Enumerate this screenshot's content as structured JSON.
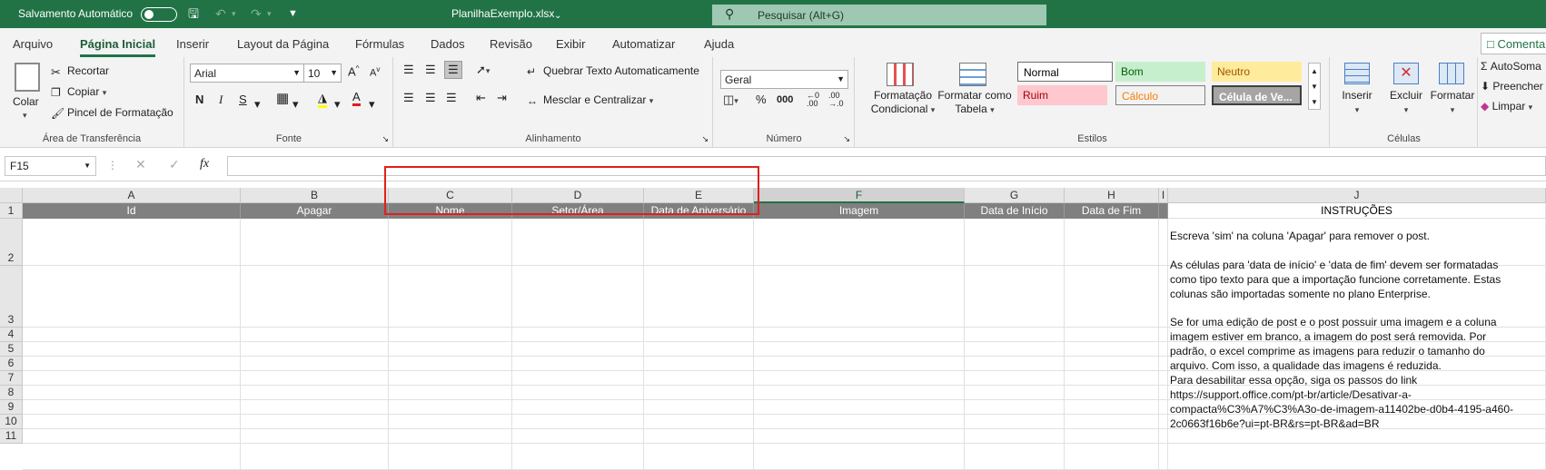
{
  "titlebar": {
    "autosave_label": "Salvamento Automático",
    "file_name": "PlanilhaExemplo.xlsx",
    "search_placeholder": "Pesquisar (Alt+G)"
  },
  "menu": {
    "items": [
      "Arquivo",
      "Página Inicial",
      "Inserir",
      "Layout da Página",
      "Fórmulas",
      "Dados",
      "Revisão",
      "Exibir",
      "Automatizar",
      "Ajuda"
    ],
    "active": "Página Inicial",
    "comment_button": "Comenta"
  },
  "ribbon": {
    "clipboard": {
      "paste": "Colar",
      "cut": "Recortar",
      "copy": "Copiar",
      "format_painter": "Pincel de Formatação",
      "label": "Área de Transferência"
    },
    "font": {
      "font_name": "Arial",
      "font_size": "10",
      "label": "Fonte",
      "bold": "N",
      "italic": "I",
      "underline": "S"
    },
    "alignment": {
      "wrap_text": "Quebrar Texto Automaticamente",
      "merge_center": "Mesclar e Centralizar",
      "label": "Alinhamento"
    },
    "number": {
      "format": "Geral",
      "label": "Número"
    },
    "styles": {
      "conditional": [
        "Formatação",
        "Condicional"
      ],
      "as_table": [
        "Formatar como",
        "Tabela"
      ],
      "items": [
        {
          "name": "Normal",
          "bg": "#ffffff",
          "fg": "#000000"
        },
        {
          "name": "Bom",
          "bg": "#c6efce",
          "fg": "#006100"
        },
        {
          "name": "Neutro",
          "bg": "#ffeb9c",
          "fg": "#9c5700"
        },
        {
          "name": "Ruim",
          "bg": "#ffc7ce",
          "fg": "#9c0006"
        },
        {
          "name": "Cálculo",
          "bg": "#f2f2f2",
          "fg": "#fa7d00"
        },
        {
          "name": "Célula de Ve...",
          "bg": "#a5a5a5",
          "fg": "#ffffff"
        }
      ],
      "label": "Estilos"
    },
    "cells": {
      "insert": "Inserir",
      "delete": "Excluir",
      "format": "Formatar",
      "label": "Células"
    },
    "editing": {
      "autosum": "AutoSoma",
      "fill": "Preencher",
      "clear": "Limpar"
    }
  },
  "formula_bar": {
    "name_box": "F15",
    "fx": "fx",
    "formula": ""
  },
  "sheet": {
    "columns": [
      "A",
      "B",
      "C",
      "D",
      "E",
      "F",
      "G",
      "H",
      "I",
      "J"
    ],
    "selected_column": "F",
    "rows": [
      "1",
      "2",
      "3",
      "4",
      "5",
      "6",
      "7",
      "8",
      "9",
      "10",
      "11"
    ],
    "header_row": [
      "Id",
      "Apagar",
      "Nome",
      "Setor/Área",
      "Data de Aniversário",
      "Imagem",
      "Data de Início",
      "Data de Fim",
      "",
      "INSTRUÇÕES"
    ],
    "instructions": [
      "Escreva 'sim' na coluna 'Apagar' para remover o post.",
      "As células para  'data de início' e 'data de fim' devem ser formatadas",
      "como tipo texto para que a importação funcione corretamente. Estas",
      "colunas são importadas somente no plano Enterprise.",
      "Se for uma edição de post e o post possuir uma imagem e a coluna",
      "imagem estiver em branco, a imagem do post será removida. Por",
      "padrão, o excel comprime as imagens para reduzir o tamanho do",
      "arquivo. Com isso, a qualidade das imagens é reduzida.",
      "Para desabilitar essa opção, siga os passos do link",
      "https://support.office.com/pt-br/article/Desativar-a-",
      "compacta%C3%A7%C3%A3o-de-imagem-a11402be-d0b4-4195-a460-",
      "2c0663f16b6e?ui=pt-BR&rs=pt-BR&ad=BR"
    ]
  },
  "colors": {
    "excel_green": "#217346",
    "header_fill": "#808080",
    "highlight": "#e0201b"
  }
}
